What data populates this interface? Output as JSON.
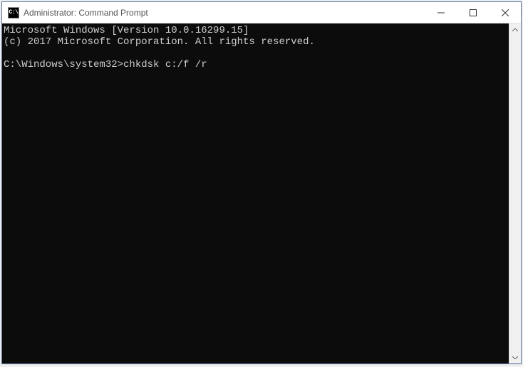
{
  "window": {
    "title": "Administrator: Command Prompt",
    "icon_label": "C:\\"
  },
  "terminal": {
    "line1": "Microsoft Windows [Version 10.0.16299.15]",
    "line2": "(c) 2017 Microsoft Corporation. All rights reserved.",
    "blank": "",
    "prompt": "C:\\Windows\\system32>",
    "command": "chkdsk c:/f /r"
  }
}
